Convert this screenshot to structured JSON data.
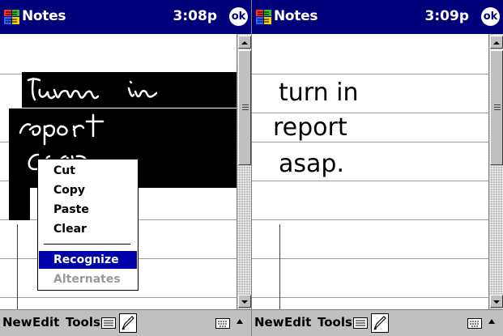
{
  "left_screen": {
    "app_title": "Notes",
    "clock": "3:08p",
    "ok_label": "ok",
    "handwriting_lines": [
      "turn in",
      "report",
      "asap"
    ],
    "context_menu": {
      "items": [
        {
          "label": "Cut",
          "state": "normal"
        },
        {
          "label": "Copy",
          "state": "normal"
        },
        {
          "label": "Paste",
          "state": "normal"
        },
        {
          "label": "Clear",
          "state": "normal"
        },
        {
          "label": "Recognize",
          "state": "highlighted"
        },
        {
          "label": "Alternates",
          "state": "disabled"
        }
      ]
    },
    "command_bar": {
      "new_label": "New",
      "edit_label": "Edit",
      "tools_label": "Tools"
    }
  },
  "right_screen": {
    "app_title": "Notes",
    "clock": "3:09p",
    "ok_label": "ok",
    "text_lines": [
      "turn in",
      "report",
      "asap."
    ],
    "command_bar": {
      "new_label": "New",
      "edit_label": "Edit",
      "tools_label": "Tools"
    }
  },
  "colors": {
    "title_bar": "#00007b",
    "menu_highlight": "#0000a8",
    "disabled_text": "#9a9a9a"
  },
  "icons": {
    "app": "notes-app-icon",
    "ok": "ok-button-icon",
    "record": "record-icon",
    "pen": "pen-icon",
    "keyboard": "keyboard-icon",
    "sip_arrow": "up-arrow-icon"
  }
}
